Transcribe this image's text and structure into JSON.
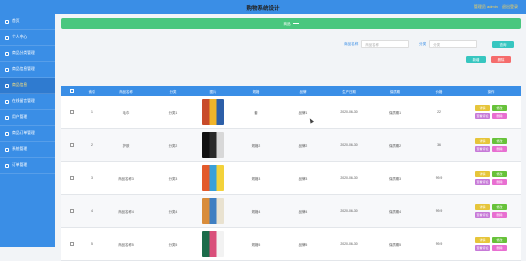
{
  "header": {
    "title": "购物系统设计",
    "user_label": "管理员 admin",
    "logout": "退出登录"
  },
  "sidebar": {
    "items": [
      {
        "label": "首页",
        "active": false
      },
      {
        "label": "个人中心",
        "active": false
      },
      {
        "label": "商品分类管理",
        "active": false
      },
      {
        "label": "商品信息管理",
        "active": false
      },
      {
        "label": "商品信息",
        "active": true
      },
      {
        "label": "在线留言管理",
        "active": false
      },
      {
        "label": "用户管理",
        "active": false
      },
      {
        "label": "商品订单管理",
        "active": false
      },
      {
        "label": "系统管理",
        "active": false
      },
      {
        "label": "订单管理",
        "active": false
      }
    ]
  },
  "banner": {
    "text": "商品"
  },
  "search": {
    "field1_label": "商品名称",
    "field1_placeholder": "商品名称",
    "field2_label": "分类",
    "field2_placeholder": "分类",
    "query_button": "查询"
  },
  "toolbar": {
    "add_button": "新增",
    "delete_button": "删除"
  },
  "table": {
    "headers": [
      "",
      "索引",
      "商品名称",
      "分类",
      "图片",
      "规格",
      "品牌",
      "生产日期",
      "保质期",
      "价格",
      "操作"
    ],
    "rows": [
      {
        "index": "1",
        "name": "毛巾",
        "category": "分类1",
        "spec": "套",
        "brand": "品牌1",
        "date": "2020-06-30",
        "shelf": "保质期1",
        "price": "22",
        "img_colors": [
          "#c84b2a",
          "#f0b429",
          "#2d5fa8"
        ]
      },
      {
        "index": "2",
        "name": "护肤",
        "category": "分类2",
        "spec": "规格2",
        "brand": "品牌2",
        "date": "2020-06-30",
        "shelf": "保质期2",
        "price": "36",
        "img_colors": [
          "#111111",
          "#2a2a2a",
          "#d8d8d8"
        ]
      },
      {
        "index": "3",
        "name": "商品名称3",
        "category": "分类3",
        "spec": "规格3",
        "brand": "品牌3",
        "date": "2020-06-30",
        "shelf": "保质期3",
        "price": "99.9",
        "img_colors": [
          "#e35a2b",
          "#3aa0d8",
          "#f3d23a"
        ]
      },
      {
        "index": "4",
        "name": "商品名称4",
        "category": "分类4",
        "spec": "规格4",
        "brand": "品牌4",
        "date": "2020-06-30",
        "shelf": "保质期4",
        "price": "99.9",
        "img_colors": [
          "#d98c3a",
          "#3f7fc2",
          "#e9e2d0"
        ]
      },
      {
        "index": "5",
        "name": "商品名称5",
        "category": "分类5",
        "spec": "规格5",
        "brand": "品牌5",
        "date": "2020-06-30",
        "shelf": "保质期5",
        "price": "99.9",
        "img_colors": [
          "#1c6b4a",
          "#d94f7a",
          "#f2f2f2"
        ]
      }
    ],
    "actions": {
      "detail": "详情",
      "edit": "修改",
      "review": "查看评论",
      "delete": "删除"
    }
  },
  "colors": {
    "primary": "#3a8ee6",
    "success": "#49c77f",
    "teal": "#37c6c0",
    "danger": "#f56c6c",
    "warning": "#e6c53a",
    "green": "#67c23a",
    "purple": "#c77ad8",
    "pink": "#e86fd1"
  }
}
